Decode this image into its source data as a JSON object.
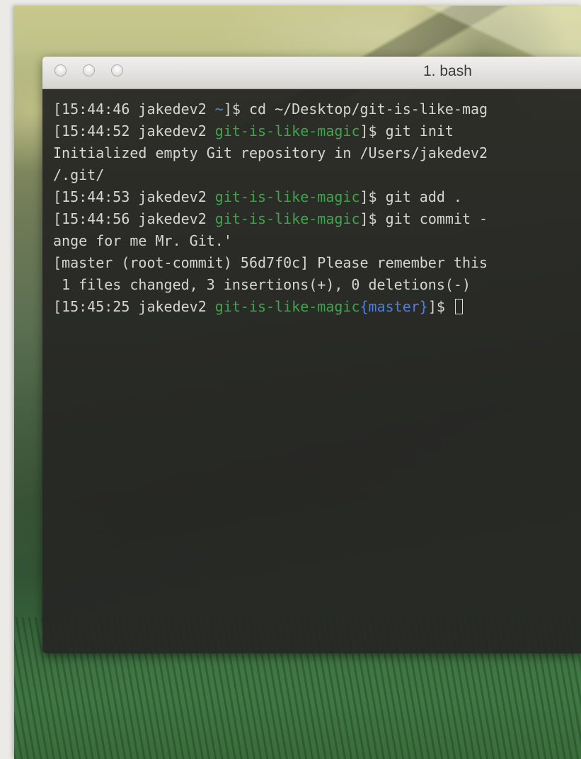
{
  "window": {
    "title": "1. bash",
    "buttons": {
      "close": "close-button",
      "minimize": "minimize-button",
      "zoom": "zoom-button"
    }
  },
  "colors": {
    "terminal_bg": "#262624",
    "text": "#d6d6d0",
    "dir": "#3fa44b",
    "branch": "#4f7fd6"
  },
  "terminal": {
    "l1": {
      "prefix": "[15:44:46 jakedev2 ",
      "dir": "~",
      "suffix": "]$ cd ~/Desktop/git-is-like-mag"
    },
    "l2": {
      "prefix": "[15:44:52 jakedev2 ",
      "dir": "git-is-like-magic",
      "suffix": "]$ git init"
    },
    "l3": {
      "text": "Initialized empty Git repository in /Users/jakedev2"
    },
    "l4": {
      "text": "/.git/"
    },
    "l5": {
      "prefix": "[15:44:53 jakedev2 ",
      "dir": "git-is-like-magic",
      "suffix": "]$ git add ."
    },
    "l6": {
      "prefix": "[15:44:56 jakedev2 ",
      "dir": "git-is-like-magic",
      "suffix": "]$ git commit -"
    },
    "l7": {
      "text": "ange for me Mr. Git.'"
    },
    "l8": {
      "text": "[master (root-commit) 56d7f0c] Please remember this"
    },
    "l9": {
      "text": " 1 files changed, 3 insertions(+), 0 deletions(-)"
    },
    "l10": {
      "prefix": "[15:45:25 jakedev2 ",
      "dir": "git-is-like-magic",
      "branch": "{master}",
      "suffix": "]$ "
    }
  }
}
